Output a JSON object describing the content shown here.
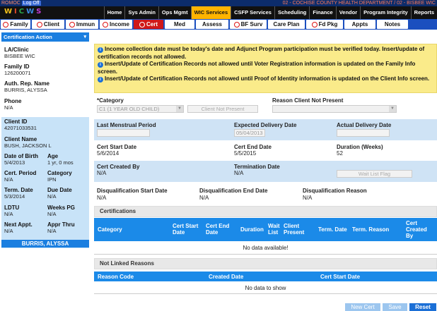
{
  "topline": {
    "user": "ROMOC",
    "logoff": "Log Off",
    "location": "02 - COCHISE COUNTY HEALTH DEPARTMENT / 02 - BISBEE WIC"
  },
  "logo": {
    "letters": [
      "W",
      "I",
      "C",
      "W",
      "S"
    ]
  },
  "mainnav": [
    "Home",
    "Sys Admin",
    "Ops Mgmt",
    "WIC Services",
    "CSFP Services",
    "Scheduling",
    "Finance",
    "Vendor",
    "Program Integrity",
    "Reports"
  ],
  "mainnav_active": "WIC Services",
  "tabs": [
    "Family",
    "Client",
    "Immun",
    "Income",
    "Cert",
    "Med",
    "Assess",
    "BF Surv",
    "Care Plan",
    "Fd Pkg",
    "Appts",
    "Notes"
  ],
  "active_tab": "Cert",
  "left": {
    "cert_action": "Certification Action",
    "la_clinic_label": "LA/Clinic",
    "la_clinic": "BISBEE WIC",
    "family_id_label": "Family ID",
    "family_id": "126200071",
    "auth_rep_label": "Auth. Rep. Name",
    "auth_rep": "BURRIS, ALYSSA",
    "phone_label": "Phone",
    "phone": "N/A",
    "client_id_label": "Client ID",
    "client_id": "42071033531",
    "client_name_label": "Client Name",
    "client_name": "BUSH, JACKSON L",
    "dob_label": "Date of Birth",
    "dob": "5/4/2013",
    "age_label": "Age",
    "age": "1 yr, 0 mos",
    "cert_period_label": "Cert. Period",
    "cert_period": "N/A",
    "category_label": "Category",
    "category": "IPN",
    "term_date_label": "Term. Date",
    "term_date": "5/3/2014",
    "due_date_label": "Due Date",
    "due_date": "N/A",
    "ldtu_label": "LDTU",
    "ldtu": "N/A",
    "weeks_pg_label": "Weeks PG",
    "weeks_pg": "N/A",
    "next_appt_label": "Next Appt.",
    "next_appt": "N/A",
    "appr_thru_label": "Appr Thru",
    "appr_thru": "N/A",
    "patient_bar": "BURRIS, ALYSSA"
  },
  "alerts": [
    "Income collection date must be today's date and Adjunct Program participation must be verified today. Insert/update of certification records not allowed.",
    "Insert/Update of Certification Records not allowed until Voter Registration information is updated on the Family Info screen.",
    "Insert/Update of Certification Records not allowed until Proof of Identity information is updated on the Client Info screen."
  ],
  "form": {
    "category_label": "*Category",
    "category_value": "C1 (1 YEAR OLD CHILD)",
    "client_not_present_btn": "Client Not Present",
    "reason_label": "Reason Client Not Present",
    "reason_value": "",
    "lmp_label": "Last Menstrual Period",
    "lmp_value": "",
    "edd_label": "Expected Delivery Date",
    "edd_value": "05/04/2013",
    "add_label": "Actual Delivery Date",
    "add_value": "",
    "cert_start_label": "Cert Start Date",
    "cert_start": "5/6/2014",
    "cert_end_label": "Cert End Date",
    "cert_end": "5/5/2015",
    "duration_label": "Duration (Weeks)",
    "duration": "52",
    "cert_created_label": "Cert Created By",
    "cert_created": "N/A",
    "termination_label": "Termination Date",
    "termination": "N/A",
    "waitlist_btn": "Wait List Flag",
    "disq_start_label": "Disqualification Start Date",
    "disq_start": "N/A",
    "disq_end_label": "Disqualification End Date",
    "disq_end": "N/A",
    "disq_reason_label": "Disqualification Reason",
    "disq_reason": "N/A"
  },
  "certifications": {
    "title": "Certifications",
    "columns": [
      "Category",
      "Cert Start Date",
      "Cert End Date",
      "Duration",
      "Wait List",
      "Client Present",
      "Term. Date",
      "Term. Reason",
      "Cert Created By"
    ],
    "no_data": "No data available!"
  },
  "not_linked": {
    "title": "Not Linked Reasons",
    "columns": [
      "Reason Code",
      "Created Date",
      "Cert Start Date"
    ],
    "no_data": "No data to show"
  },
  "buttons": {
    "new_cert": "New Cert",
    "save": "Save",
    "reset": "Reset"
  }
}
